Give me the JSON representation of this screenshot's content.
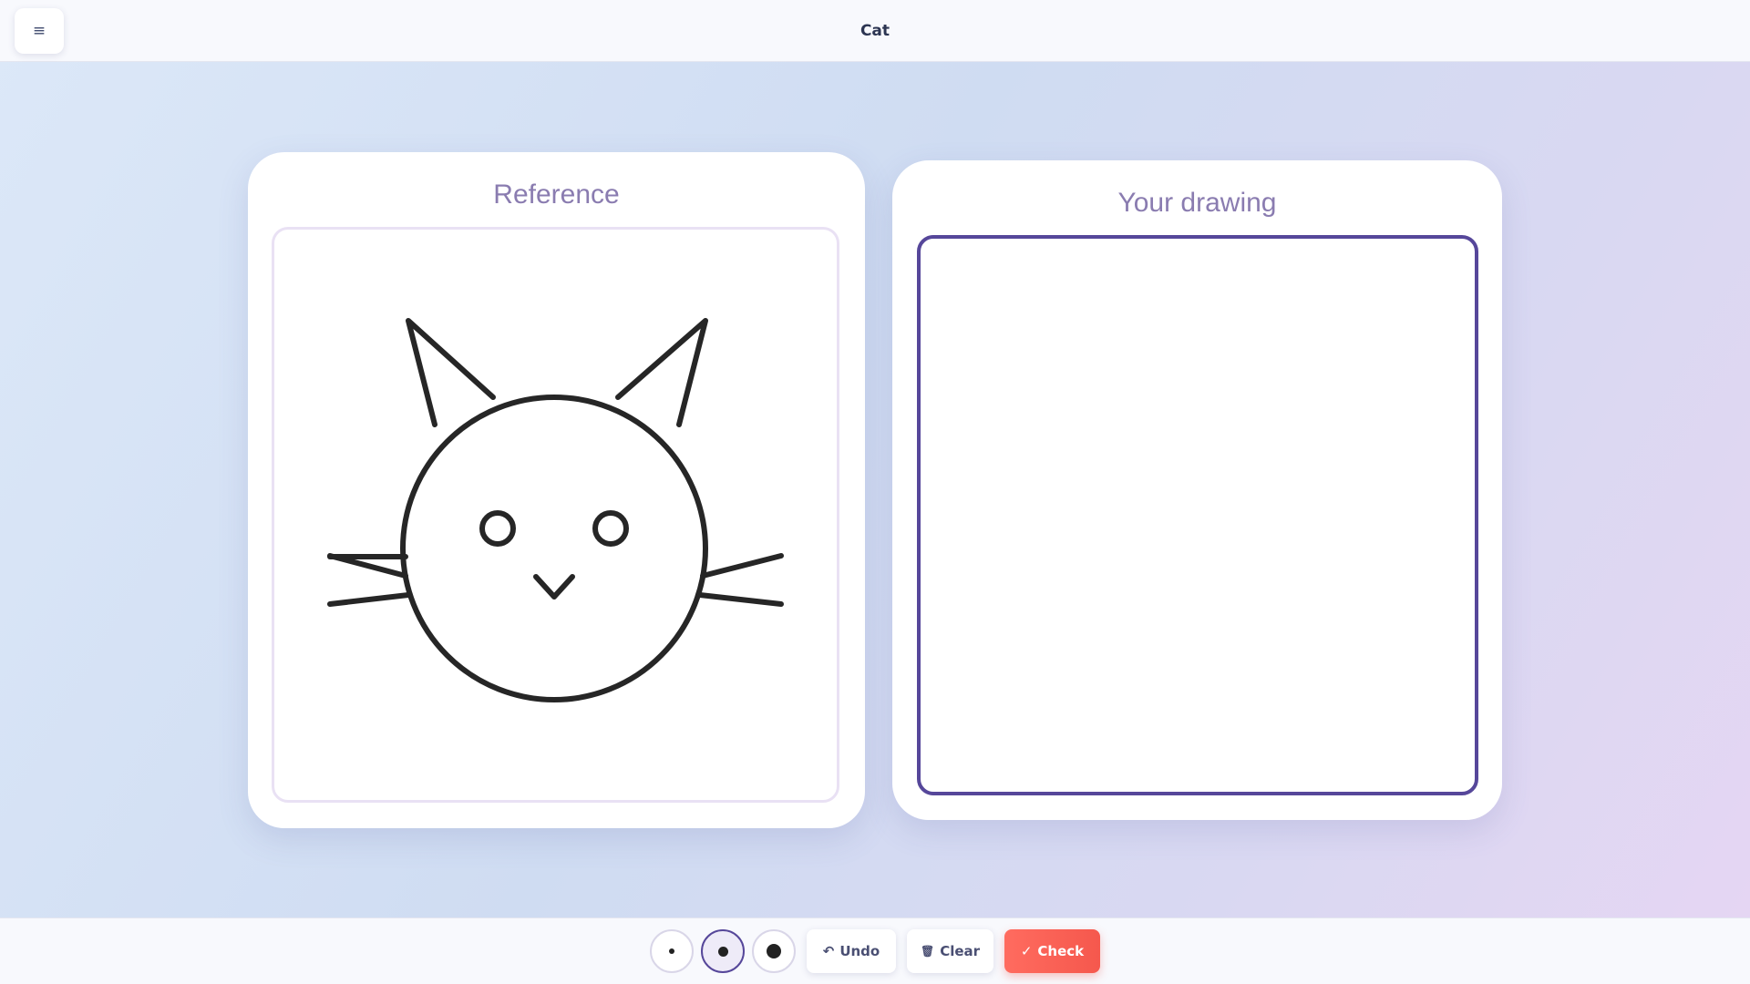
{
  "header": {
    "menu_icon": "hamburger-menu-icon",
    "menu_glyph": "≡",
    "title": "Cat"
  },
  "reference": {
    "title": "Reference",
    "image": "cat-outline-drawing"
  },
  "drawing": {
    "title": "Your drawing"
  },
  "toolbar": {
    "brush_sizes": [
      "small",
      "medium",
      "large"
    ],
    "selected_brush_size": "medium",
    "undo_icon": "↶",
    "undo_label": "Undo",
    "clear_icon": "🗑",
    "clear_label": "Clear",
    "check_icon": "✓",
    "check_label": "Check"
  },
  "colors": {
    "accent": "#56479a",
    "title_purple": "#8a7cb0",
    "check_button": "#f5584d"
  }
}
